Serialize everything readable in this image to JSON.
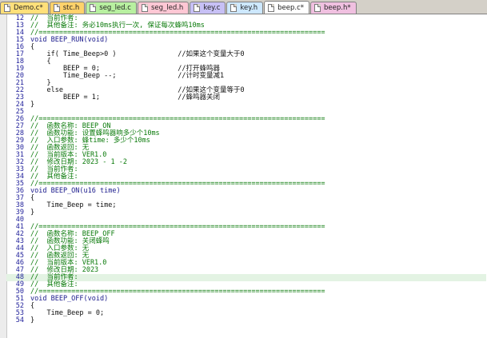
{
  "tabs": [
    {
      "label": "Demo.c*",
      "color": "#ffe07a",
      "active": false
    },
    {
      "label": "stc.h",
      "color": "#ffd26a",
      "active": false
    },
    {
      "label": "seg_led.c",
      "color": "#b8f0a0",
      "active": false
    },
    {
      "label": "seg_led.h",
      "color": "#ffc7d4",
      "active": false
    },
    {
      "label": "key.c",
      "color": "#c7c0f5",
      "active": false
    },
    {
      "label": "key.h",
      "color": "#cde8ff",
      "active": false
    },
    {
      "label": "beep.c*",
      "color": "#ffb15a",
      "active": true
    },
    {
      "label": "beep.h*",
      "color": "#f0c0e0",
      "active": false
    }
  ],
  "lines": [
    {
      "n": "12",
      "text": "//  当前作者:",
      "cls": "t-comment"
    },
    {
      "n": "13",
      "text": "//  其他备注: 务必10ms执行一次, 保证每次蜂鸣10ms",
      "cls": "t-comment"
    },
    {
      "n": "14",
      "text": "//======================================================================",
      "cls": "t-comment"
    },
    {
      "n": "15",
      "text": "void BEEP_RUN(void)",
      "cls": "t-key"
    },
    {
      "n": "16",
      "text": "{",
      "cls": "t-norm"
    },
    {
      "n": "17",
      "text": "    if( Time_Beep>0 )               //如果这个变量大于0",
      "cls": "t-norm"
    },
    {
      "n": "18",
      "text": "    {",
      "cls": "t-norm"
    },
    {
      "n": "19",
      "text": "        BEEP = 0;                   //打开蜂鸣器",
      "cls": "t-norm"
    },
    {
      "n": "20",
      "text": "        Time_Beep --;               //计时变量减1",
      "cls": "t-norm"
    },
    {
      "n": "21",
      "text": "    }",
      "cls": "t-norm"
    },
    {
      "n": "22",
      "text": "    else                            //如果这个变量等于0",
      "cls": "t-norm"
    },
    {
      "n": "23",
      "text": "        BEEP = 1;                   //蜂鸣器关闭",
      "cls": "t-norm"
    },
    {
      "n": "24",
      "text": "}",
      "cls": "t-norm"
    },
    {
      "n": "25",
      "text": "",
      "cls": "t-norm"
    },
    {
      "n": "26",
      "text": "//======================================================================",
      "cls": "t-comment"
    },
    {
      "n": "27",
      "text": "//  函数名称: BEEP_ON",
      "cls": "t-comment"
    },
    {
      "n": "28",
      "text": "//  函数功能: 设置蜂鸣器响多少个10ms",
      "cls": "t-comment"
    },
    {
      "n": "29",
      "text": "//  入口参数: 蜂time: 多少个10ms",
      "cls": "t-comment"
    },
    {
      "n": "30",
      "text": "//  函数返回: 无",
      "cls": "t-comment"
    },
    {
      "n": "31",
      "text": "//  当前版本: VER1.0",
      "cls": "t-comment"
    },
    {
      "n": "32",
      "text": "//  修改日期: 2023 - 1 -2",
      "cls": "t-comment"
    },
    {
      "n": "33",
      "text": "//  当前作者:",
      "cls": "t-comment"
    },
    {
      "n": "34",
      "text": "//  其他备注:",
      "cls": "t-comment"
    },
    {
      "n": "35",
      "text": "//======================================================================",
      "cls": "t-comment"
    },
    {
      "n": "36",
      "text": "void BEEP_ON(u16 time)",
      "cls": "t-key"
    },
    {
      "n": "37",
      "text": "{",
      "cls": "t-norm"
    },
    {
      "n": "38",
      "text": "    Time_Beep = time;",
      "cls": "t-norm"
    },
    {
      "n": "39",
      "text": "}",
      "cls": "t-norm"
    },
    {
      "n": "40",
      "text": "",
      "cls": "t-norm"
    },
    {
      "n": "41",
      "text": "//======================================================================",
      "cls": "t-comment"
    },
    {
      "n": "42",
      "text": "//  函数名称: BEEP_OFF",
      "cls": "t-comment"
    },
    {
      "n": "43",
      "text": "//  函数功能: 关闭蜂鸣",
      "cls": "t-comment"
    },
    {
      "n": "44",
      "text": "//  入口参数: 无",
      "cls": "t-comment"
    },
    {
      "n": "45",
      "text": "//  函数返回: 无",
      "cls": "t-comment"
    },
    {
      "n": "46",
      "text": "//  当前版本: VER1.0",
      "cls": "t-comment"
    },
    {
      "n": "47",
      "text": "//  修改日期: 2023",
      "cls": "t-comment"
    },
    {
      "n": "48",
      "text": "//  当前作者:",
      "cls": "t-comment",
      "highlight": true
    },
    {
      "n": "49",
      "text": "//  其他备注:",
      "cls": "t-comment"
    },
    {
      "n": "50",
      "text": "//======================================================================",
      "cls": "t-comment"
    },
    {
      "n": "51",
      "text": "void BEEP_OFF(void)",
      "cls": "t-key"
    },
    {
      "n": "52",
      "text": "{",
      "cls": "t-norm"
    },
    {
      "n": "53",
      "text": "    Time_Beep = 0;",
      "cls": "t-norm"
    },
    {
      "n": "54",
      "text": "}",
      "cls": "t-norm"
    }
  ]
}
